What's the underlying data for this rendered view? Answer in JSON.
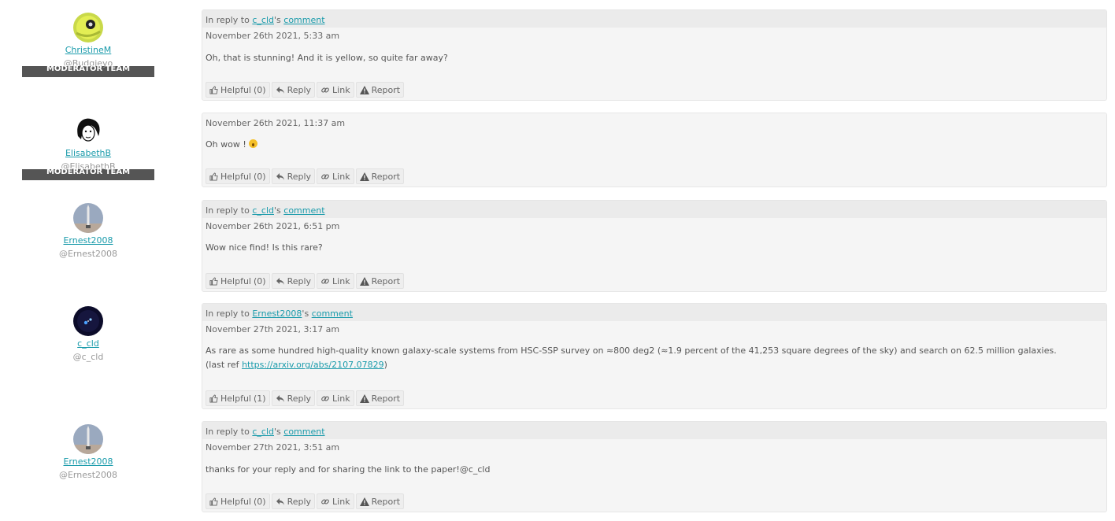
{
  "ui": {
    "reply_in": "In reply to",
    "reply_possessive": "'s",
    "comment_link": "comment",
    "helpful_label": "Helpful",
    "reply_label": "Reply",
    "link_label": "Link",
    "report_label": "Report",
    "moderator_badge": "MODERATOR TEAM"
  },
  "comments": [
    {
      "author": "ChristineM",
      "handle": "@Budgieyo",
      "moderator": true,
      "reply_to": "c_cld",
      "date": "November 26th 2021, 5:33 am",
      "text": "Oh, that is stunning! And it is yellow, so quite far away?",
      "helpful": "(0)"
    },
    {
      "author": "ElisabethB",
      "handle": "@ElisabethB",
      "moderator": true,
      "reply_to": "",
      "date": "November 26th 2021, 11:37 am",
      "text": "Oh wow !",
      "helpful": "(0)"
    },
    {
      "author": "Ernest2008",
      "handle": "@Ernest2008",
      "moderator": false,
      "reply_to": "c_cld",
      "date": "November 26th 2021, 6:51 pm",
      "text": "Wow nice find! Is this rare?",
      "helpful": "(0)"
    },
    {
      "author": "c_cld",
      "handle": "@c_cld",
      "moderator": false,
      "reply_to": "Ernest2008",
      "date": "November 27th 2021, 3:17 am",
      "text": "As rare as some hundred high-quality known galaxy-scale systems from HSC-SSP survey on ≈800 deg2 (≈1.9 percent of the 41,253 square degrees of the sky) and search on 62.5 million galaxies.",
      "text2_prefix": "(last ref",
      "text2_link": "https://arxiv.org/abs/2107.07829",
      "text2_suffix": ")",
      "helpful": "(1)"
    },
    {
      "author": "Ernest2008",
      "handle": "@Ernest2008",
      "moderator": false,
      "reply_to": "c_cld",
      "date": "November 27th 2021, 3:51 am",
      "text": "thanks for your reply and for sharing the link to the paper!@c_cld",
      "helpful": "(0)"
    }
  ],
  "colors": {
    "link": "#1a9bab",
    "badge": "#555555",
    "card": "#f5f5f5"
  },
  "icons": [
    "thumbs-up-icon",
    "reply-icon",
    "link-icon",
    "warning-icon",
    "astonished-emoji-icon"
  ]
}
